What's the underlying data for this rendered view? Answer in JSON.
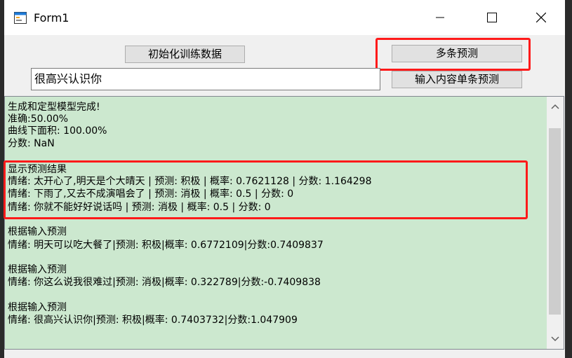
{
  "window": {
    "title": "Form1"
  },
  "toolbar": {
    "init_label": "初始化训练数据",
    "multi_predict_label": "多条预测",
    "single_predict_label": "输入内容单条预测"
  },
  "input": {
    "value": "很高兴认识你"
  },
  "output": {
    "lines": [
      "生成和定型模型完成!",
      "准确:50.00%",
      "曲线下面积: 100.00%",
      "分数: NaN",
      "",
      "显示预测结果",
      "情绪: 太开心了,明天是个大晴天 | 预测: 积极 | 概率: 0.7621128 | 分数: 1.164298",
      "情绪: 下雨了,又去不成演唱会了 | 预测: 消极 | 概率: 0.5 | 分数: 0",
      "情绪: 你就不能好好说话吗 | 预测: 消极 | 概率: 0.5 | 分数: 0",
      "",
      "根据输入预测",
      "情绪: 明天可以吃大餐了|预测: 积极|概率: 0.6772109|分数:0.7409837",
      "",
      "根据输入预测",
      "情绪: 你这么说我很难过|预测: 消极|概率: 0.322789|分数:-0.7409838",
      "",
      "根据输入预测",
      "情绪: 很高兴认识你|预测: 积极|概率: 0.7403732|分数:1.047909"
    ]
  },
  "colors": {
    "output_bg": "#cce8cf",
    "highlight": "#ff1a1a"
  }
}
